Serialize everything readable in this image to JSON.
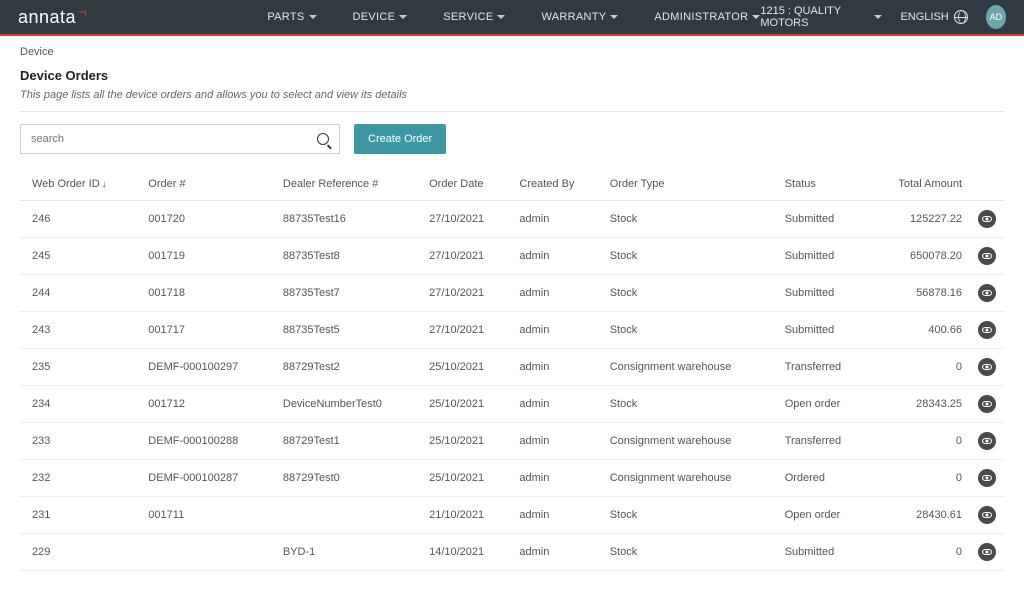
{
  "logo": "annata",
  "nav": [
    "PARTS",
    "DEVICE",
    "SERVICE",
    "WARRANTY",
    "ADMINISTRATOR"
  ],
  "dealer": "1215 : QUALITY MOTORS",
  "language": "ENGLISH",
  "avatar": "AD",
  "breadcrumb": "Device",
  "title": "Device Orders",
  "subtitle": "This page lists all the device orders and allows you to select and view its details",
  "search_placeholder": "search",
  "create_label": "Create Order",
  "columns": {
    "web_order_id": "Web Order ID",
    "order_no": "Order #",
    "dealer_ref": "Dealer Reference #",
    "order_date": "Order Date",
    "created_by": "Created By",
    "order_type": "Order Type",
    "status": "Status",
    "total": "Total Amount"
  },
  "rows": [
    {
      "id": "246",
      "order": "001720",
      "ref": "88735Test16",
      "date": "27/10/2021",
      "by": "admin",
      "type": "Stock",
      "status": "Submitted",
      "total": "125227.22"
    },
    {
      "id": "245",
      "order": "001719",
      "ref": "88735Test8",
      "date": "27/10/2021",
      "by": "admin",
      "type": "Stock",
      "status": "Submitted",
      "total": "650078.20"
    },
    {
      "id": "244",
      "order": "001718",
      "ref": "88735Test7",
      "date": "27/10/2021",
      "by": "admin",
      "type": "Stock",
      "status": "Submitted",
      "total": "56878.16"
    },
    {
      "id": "243",
      "order": "001717",
      "ref": "88735Test5",
      "date": "27/10/2021",
      "by": "admin",
      "type": "Stock",
      "status": "Submitted",
      "total": "400.66"
    },
    {
      "id": "235",
      "order": "DEMF-000100297",
      "ref": "88729Test2",
      "date": "25/10/2021",
      "by": "admin",
      "type": "Consignment warehouse",
      "status": "Transferred",
      "total": "0"
    },
    {
      "id": "234",
      "order": "001712",
      "ref": "DeviceNumberTest0",
      "date": "25/10/2021",
      "by": "admin",
      "type": "Stock",
      "status": "Open order",
      "total": "28343.25"
    },
    {
      "id": "233",
      "order": "DEMF-000100288",
      "ref": "88729Test1",
      "date": "25/10/2021",
      "by": "admin",
      "type": "Consignment warehouse",
      "status": "Transferred",
      "total": "0"
    },
    {
      "id": "232",
      "order": "DEMF-000100287",
      "ref": "88729Test0",
      "date": "25/10/2021",
      "by": "admin",
      "type": "Consignment warehouse",
      "status": "Ordered",
      "total": "0"
    },
    {
      "id": "231",
      "order": "001711",
      "ref": "",
      "date": "21/10/2021",
      "by": "admin",
      "type": "Stock",
      "status": "Open order",
      "total": "28430.61"
    },
    {
      "id": "229",
      "order": "",
      "ref": "BYD-1",
      "date": "14/10/2021",
      "by": "admin",
      "type": "Stock",
      "status": "Submitted",
      "total": "0"
    }
  ]
}
